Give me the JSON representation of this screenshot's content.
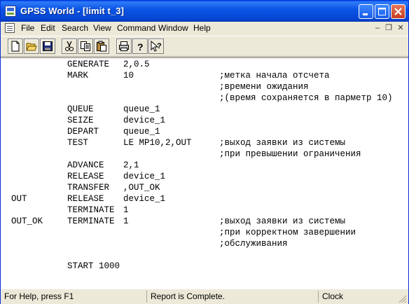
{
  "window": {
    "title": "GPSS World - [limit t_3]"
  },
  "menu": [
    "File",
    "Edit",
    "Search",
    "View",
    "Command",
    "Window",
    "Help"
  ],
  "toolbar": [
    "new-icon",
    "open-icon",
    "save-icon",
    "cut-icon",
    "copy-icon",
    "paste-icon",
    "print-icon",
    "help-icon",
    "context-help-icon"
  ],
  "code": [
    {
      "label": "",
      "op": "GENERATE",
      "arg": "2,0.5",
      "comment": ""
    },
    {
      "label": "",
      "op": "MARK",
      "arg": "10",
      "comment": ";метка начала отсчета"
    },
    {
      "label": "",
      "op": "",
      "arg": "",
      "comment": ";времени ожидания"
    },
    {
      "label": "",
      "op": "",
      "arg": "",
      "comment": ";(время сохраняется в парметр 10)"
    },
    {
      "label": "",
      "op": "QUEUE",
      "arg": "queue_1",
      "comment": ""
    },
    {
      "label": "",
      "op": "SEIZE",
      "arg": "device_1",
      "comment": ""
    },
    {
      "label": "",
      "op": "DEPART",
      "arg": "queue_1",
      "comment": ""
    },
    {
      "label": "",
      "op": "TEST",
      "arg": "LE MP10,2,OUT",
      "comment": ";выход заявки из системы"
    },
    {
      "label": "",
      "op": "",
      "arg": "",
      "comment": ";при превышении ограничения"
    },
    {
      "label": "",
      "op": "ADVANCE",
      "arg": "2,1",
      "comment": ""
    },
    {
      "label": "",
      "op": "RELEASE",
      "arg": "device_1",
      "comment": ""
    },
    {
      "label": "",
      "op": "TRANSFER",
      "arg": ",OUT_OK",
      "comment": ""
    },
    {
      "label": "OUT",
      "op": "RELEASE",
      "arg": "device_1",
      "comment": ""
    },
    {
      "label": "",
      "op": "TERMINATE",
      "arg": "1",
      "comment": ""
    },
    {
      "label": "OUT_OK",
      "op": "TERMINATE",
      "arg": "1",
      "comment": ";выход заявки из системы"
    },
    {
      "label": "",
      "op": "",
      "arg": "",
      "comment": ";при корректном завершении"
    },
    {
      "label": "",
      "op": "",
      "arg": "",
      "comment": ";обслуживания"
    },
    {
      "label": "",
      "op": "",
      "arg": "",
      "comment": ""
    },
    {
      "label": "",
      "op": "START 1000",
      "arg": "",
      "comment": ""
    }
  ],
  "status": {
    "help": "For Help, press F1",
    "message": "Report is Complete.",
    "clock": "Clock"
  }
}
